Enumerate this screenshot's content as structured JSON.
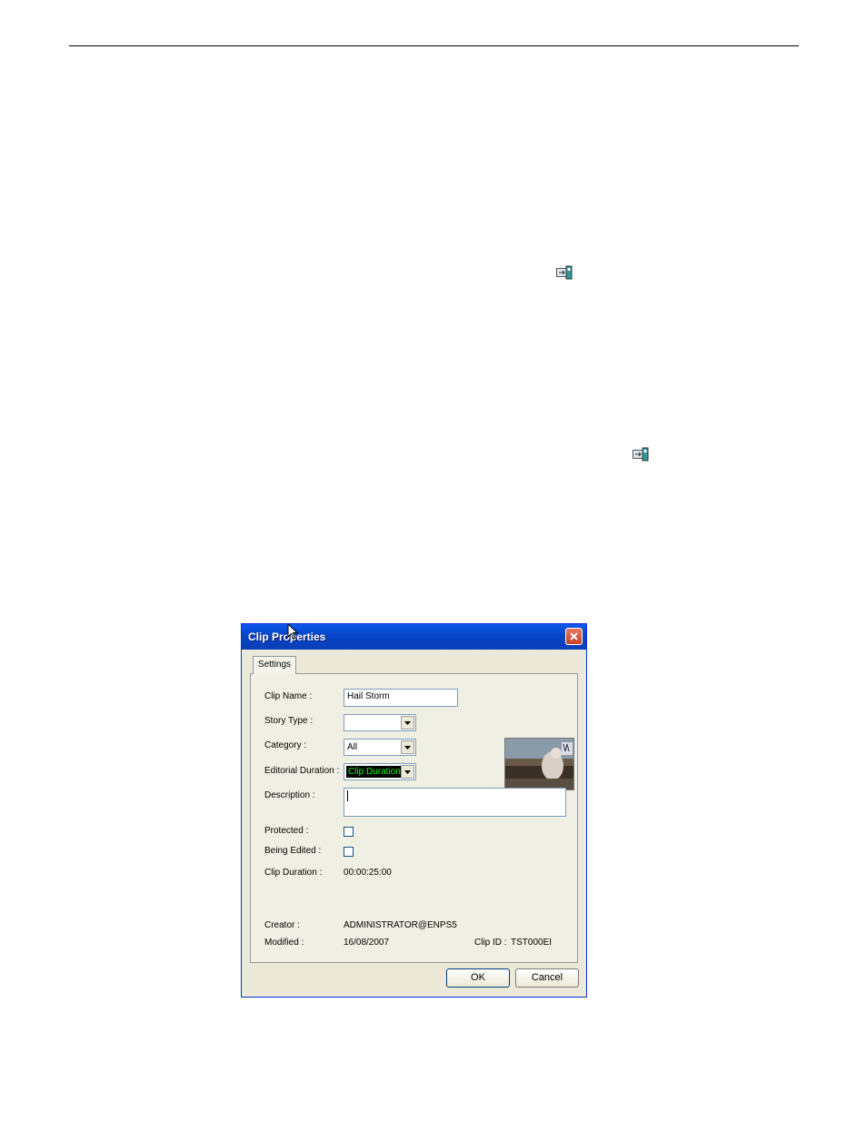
{
  "dialog": {
    "title": "Clip Properties",
    "tab_label": "Settings",
    "labels": {
      "clip_name": "Clip Name :",
      "story_type": "Story Type :",
      "category": "Category :",
      "editorial_duration": "Editorial Duration :",
      "description": "Description :",
      "protected": "Protected :",
      "being_edited": "Being Edited :",
      "clip_duration": "Clip Duration :",
      "creator": "Creator :",
      "modified": "Modified :",
      "clip_id": "Clip ID :"
    },
    "values": {
      "clip_name": "Hail Storm",
      "story_type": "",
      "category": "All",
      "editorial_duration": "Clip Duration",
      "description": "",
      "protected": false,
      "being_edited": false,
      "clip_duration": "00:00:25:00",
      "creator": "ADMINISTRATOR@ENPS5",
      "modified": "16/08/2007",
      "clip_id": "TST000EI"
    },
    "buttons": {
      "ok": "OK",
      "cancel": "Cancel"
    }
  },
  "icons": [
    "clip-properties-icon",
    "close-icon",
    "dropdown-arrow-icon",
    "mouse-cursor-icon"
  ],
  "colors": {
    "titlebar": "#0a4fd8",
    "dialog_bg": "#ece9d8",
    "editorial_highlight_bg": "#000000",
    "editorial_highlight_text": "#00ff00"
  }
}
